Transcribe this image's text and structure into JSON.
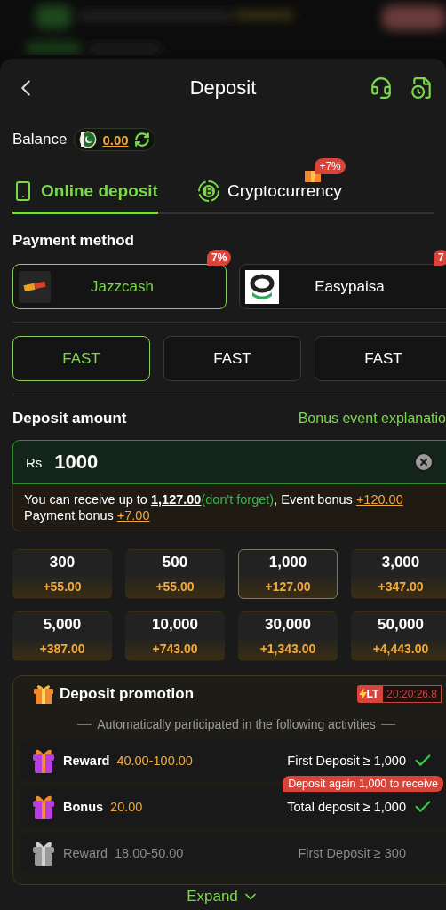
{
  "header": {
    "title": "Deposit"
  },
  "balance": {
    "label": "Balance",
    "amount": "0.00"
  },
  "tabs": [
    {
      "label": "Online deposit",
      "selected": true,
      "kind": "phone"
    },
    {
      "label": "Cryptocurrency",
      "selected": false,
      "kind": "crypto",
      "badge": "+7%"
    }
  ],
  "payment_method": {
    "title": "Payment method",
    "methods": [
      {
        "name": "Jazzcash",
        "selected": true,
        "badge": "7%",
        "kind": "jazzcash"
      },
      {
        "name": "Easypaisa",
        "selected": false,
        "badge": "7",
        "kind": "easypaisa"
      }
    ]
  },
  "channels": [
    {
      "label": "FAST",
      "selected": true
    },
    {
      "label": "FAST",
      "selected": false
    },
    {
      "label": "FAST",
      "selected": false
    }
  ],
  "deposit_amount": {
    "title": "Deposit amount",
    "link": "Bonus event explanatio",
    "currency": "Rs",
    "value": "1000",
    "info": [
      {
        "kind": "plain",
        "text": "You can receive up to "
      },
      {
        "kind": "total",
        "text": "1,127.00"
      },
      {
        "kind": "note",
        "text": "(don't forget)"
      },
      {
        "kind": "plain",
        "text": ", Event bonus "
      },
      {
        "kind": "bonus",
        "text": "+120.00"
      },
      {
        "kind": "break",
        "text": "Payment bonus "
      },
      {
        "kind": "bonus",
        "text": "+7.00"
      }
    ]
  },
  "amounts": [
    {
      "amount": "300",
      "bonus": "+55.00",
      "selected": false
    },
    {
      "amount": "500",
      "bonus": "+55.00",
      "selected": false
    },
    {
      "amount": "1,000",
      "bonus": "+127.00",
      "selected": true
    },
    {
      "amount": "3,000",
      "bonus": "+347.00",
      "selected": false
    },
    {
      "amount": "5,000",
      "bonus": "+387.00",
      "selected": false
    },
    {
      "amount": "10,000",
      "bonus": "+743.00",
      "selected": false
    },
    {
      "amount": "30,000",
      "bonus": "+1,343.00",
      "selected": false
    },
    {
      "amount": "50,000",
      "bonus": "+4,443.00",
      "selected": false
    }
  ],
  "promotion": {
    "title": "Deposit promotion",
    "tag": "LT",
    "timer": "20:20:26.8",
    "subtitle": "Automatically participated in the following activities",
    "items": [
      {
        "label": "Reward",
        "value": "40.00-100.00",
        "condition": "First Deposit ≥ 1,000",
        "done": true,
        "active": true
      },
      {
        "label": "Bonus",
        "value": "20.00",
        "condition": "Total deposit ≥ 1,000",
        "done": true,
        "active": true,
        "tooltip": "Deposit again 1,000 to receive"
      },
      {
        "label": "Reward",
        "value": "18.00-50.00",
        "condition": "First Deposit ≥ 300",
        "done": false,
        "active": false
      }
    ]
  },
  "expand": {
    "label": "Expand"
  }
}
